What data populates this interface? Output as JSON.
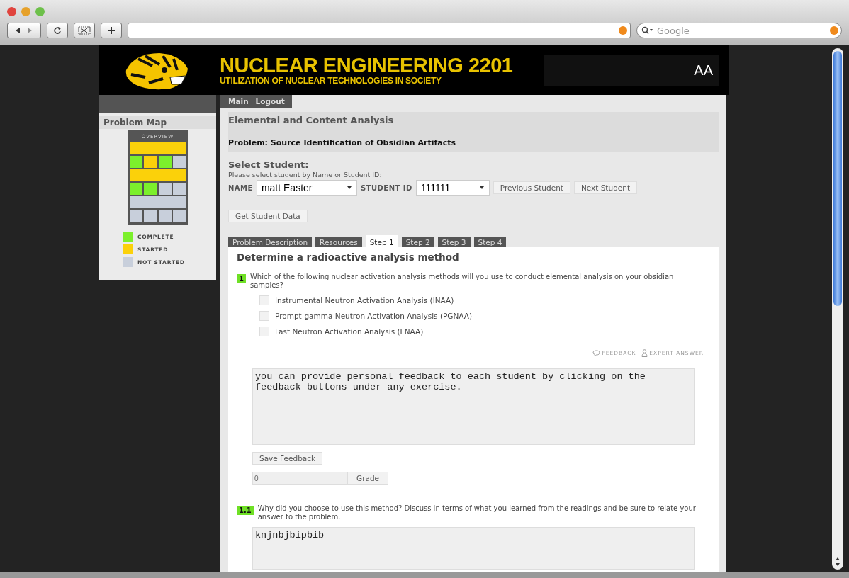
{
  "browser": {
    "search": {
      "placeholder": "Google"
    }
  },
  "header": {
    "title": "NUCLEAR ENGINEERING 2201",
    "subtitle": "UTILIZATION OF NUCLEAR TECHNOLOGIES IN SOCIETY",
    "text_size_button": "AA"
  },
  "sidebar": {
    "title": "Problem Map",
    "overview": "OVERVIEW",
    "rows": [
      [
        {
          "color": "#fbd10a"
        }
      ],
      [
        {
          "color": "#7cf02c"
        },
        {
          "color": "#fbd10a"
        },
        {
          "color": "#7cf02c"
        },
        {
          "color": "#c8cfdb"
        }
      ],
      [
        {
          "color": "#fbd10a"
        }
      ],
      [
        {
          "color": "#7cf02c"
        },
        {
          "color": "#7cf02c"
        },
        {
          "color": "#c8cfdb"
        },
        {
          "color": "#c8cfdb"
        }
      ],
      [
        {
          "color": "#c8cfdb"
        }
      ],
      [
        {
          "color": "#c8cfdb"
        },
        {
          "color": "#c8cfdb"
        },
        {
          "color": "#c8cfdb"
        },
        {
          "color": "#c8cfdb"
        }
      ]
    ],
    "legend": [
      {
        "color": "#7cf02c",
        "label": "COMPLETE"
      },
      {
        "color": "#fbd10a",
        "label": "STARTED"
      },
      {
        "color": "#c8cfdb",
        "label": "NOT STARTED"
      }
    ]
  },
  "nav": [
    "Main",
    "Logout"
  ],
  "section_title": "Elemental and Content Analysis",
  "problem_title": "Problem: Source Identification of Obsidian Artifacts",
  "select_student": {
    "heading": "Select Student:",
    "hint": "Please select student by Name or Student ID:",
    "name_label": "NAME",
    "name_value": "matt Easter",
    "id_label": "STUDENT ID",
    "id_value": "111111",
    "buttons": [
      "Previous Student",
      "Next Student"
    ],
    "get_data": "Get Student Data"
  },
  "tabs": [
    {
      "label": "Problem Description",
      "selected": false
    },
    {
      "label": "Resources",
      "selected": false
    },
    {
      "label": "Step 1",
      "selected": true
    },
    {
      "label": "Step 2",
      "selected": false
    },
    {
      "label": "Step 3",
      "selected": false
    },
    {
      "label": "Step 4",
      "selected": false
    }
  ],
  "step_title": "Determine a radioactive analysis method",
  "question": {
    "number": "1",
    "text": "Which of the following nuclear activation analysis methods will you use to conduct elemental analysis on your obsidian samples?",
    "options": [
      {
        "label": "Instrumental Neutron Activation Analysis (INAA)",
        "checked": false
      },
      {
        "label": "Prompt-gamma Neutron Activation Analysis (PGNAA)",
        "checked": false
      },
      {
        "label": "Fast Neutron Activation Analysis (FNAA)",
        "checked": false
      }
    ],
    "feedback_link": "FEEDBACK",
    "expert_link": "EXPERT ANSWER",
    "feedback_text": "you can provide personal feedback to each student by clicking on the feedback buttons under any exercise.",
    "save_button": "Save Feedback",
    "grade_value": "0",
    "grade_button": "Grade"
  },
  "question2": {
    "number": "1.1",
    "text": "Why did you choose to use this method? Discuss in terms of what you learned from the readings and be sure to relate your answer to the problem.",
    "answer": "knjnbjbipbib"
  }
}
